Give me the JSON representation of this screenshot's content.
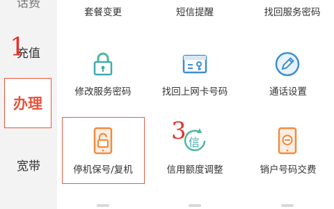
{
  "sidebar": {
    "top_partial": "话费",
    "items": [
      {
        "label": "充值",
        "annotation": "1"
      },
      {
        "label": "办理"
      },
      {
        "label": "宽带"
      }
    ]
  },
  "top_row": [
    "套餐变更",
    "短信提醒",
    "找回服务密码"
  ],
  "row2": [
    {
      "label": "修改服务密码",
      "icon": "lock-icon"
    },
    {
      "label": "找回上网卡号码",
      "icon": "card-key-icon"
    },
    {
      "label": "通话设置",
      "icon": "pencil-icon"
    }
  ],
  "row3": [
    {
      "label": "停机保号/复机",
      "icon": "phone-unlock-icon"
    },
    {
      "label": "信用额度调整",
      "icon": "credit-refresh-icon",
      "badge": "信",
      "annotation": "3"
    },
    {
      "label": "销户号码交费",
      "icon": "phone-minus-icon"
    }
  ],
  "colors": {
    "accent": "#e8533a",
    "annotation": "#e2342b",
    "icon_teal": "#3fa9b3",
    "icon_blue": "#3d8ed0",
    "icon_orange": "#f08b3e",
    "icon_green": "#4bb89a"
  }
}
